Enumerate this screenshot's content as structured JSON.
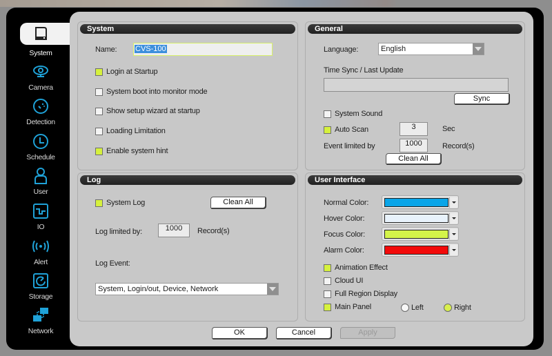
{
  "sidebar": {
    "items": [
      {
        "label": "System",
        "icon": "system-icon",
        "active": true
      },
      {
        "label": "Camera",
        "icon": "camera-icon"
      },
      {
        "label": "Detection",
        "icon": "detection-icon"
      },
      {
        "label": "Schedule",
        "icon": "clock-icon"
      },
      {
        "label": "User",
        "icon": "user-icon"
      },
      {
        "label": "IO",
        "icon": "io-icon"
      },
      {
        "label": "Alert",
        "icon": "alert-icon"
      },
      {
        "label": "Storage",
        "icon": "storage-icon"
      },
      {
        "label": "Network",
        "icon": "network-icon"
      }
    ],
    "accent_color": "#1fa2d8"
  },
  "system_panel": {
    "title": "System",
    "name_label": "Name:",
    "name_value": "CVS-100",
    "options": [
      {
        "label": "Login at Startup",
        "checked": true
      },
      {
        "label": "System boot into monitor mode",
        "checked": false
      },
      {
        "label": "Show setup wizard at startup",
        "checked": false
      },
      {
        "label": "Loading Limitation",
        "checked": false
      },
      {
        "label": "Enable system hint",
        "checked": true
      }
    ]
  },
  "general_panel": {
    "title": "General",
    "language_label": "Language:",
    "language_value": "English",
    "time_sync_label": "Time Sync / Last Update",
    "time_sync_value": "",
    "sync_button": "Sync",
    "system_sound": {
      "label": "System Sound",
      "checked": false
    },
    "auto_scan": {
      "label": "Auto Scan",
      "checked": true,
      "value": "3",
      "unit": "Sec"
    },
    "event_limit": {
      "label": "Event limited by",
      "value": "1000",
      "unit": "Record(s)"
    },
    "clean_all_button": "Clean All"
  },
  "log_panel": {
    "title": "Log",
    "system_log": {
      "label": "System Log",
      "checked": true
    },
    "clean_all_button": "Clean All",
    "log_limit": {
      "label": "Log limited by:",
      "value": "1000",
      "unit": "Record(s)"
    },
    "log_event_label": "Log Event:",
    "log_event_value": "System, Login/out, Device, Network"
  },
  "ui_panel": {
    "title": "User Interface",
    "colors": [
      {
        "label": "Normal Color:",
        "value": "#0aa5e8"
      },
      {
        "label": "Hover Color:",
        "value": "#e8f2fb"
      },
      {
        "label": "Focus Color:",
        "value": "#d4f44a"
      },
      {
        "label": "Alarm Color:",
        "value": "#f20a0a"
      }
    ],
    "options": [
      {
        "label": "Animation Effect",
        "checked": true
      },
      {
        "label": "Cloud UI",
        "checked": false
      },
      {
        "label": "Full Region Display",
        "checked": false
      },
      {
        "label": "Main Panel",
        "checked": true
      }
    ],
    "main_panel_position": {
      "options": [
        "Left",
        "Right"
      ],
      "selected": "Right"
    }
  },
  "footer": {
    "ok": "OK",
    "cancel": "Cancel",
    "apply": "Apply"
  }
}
